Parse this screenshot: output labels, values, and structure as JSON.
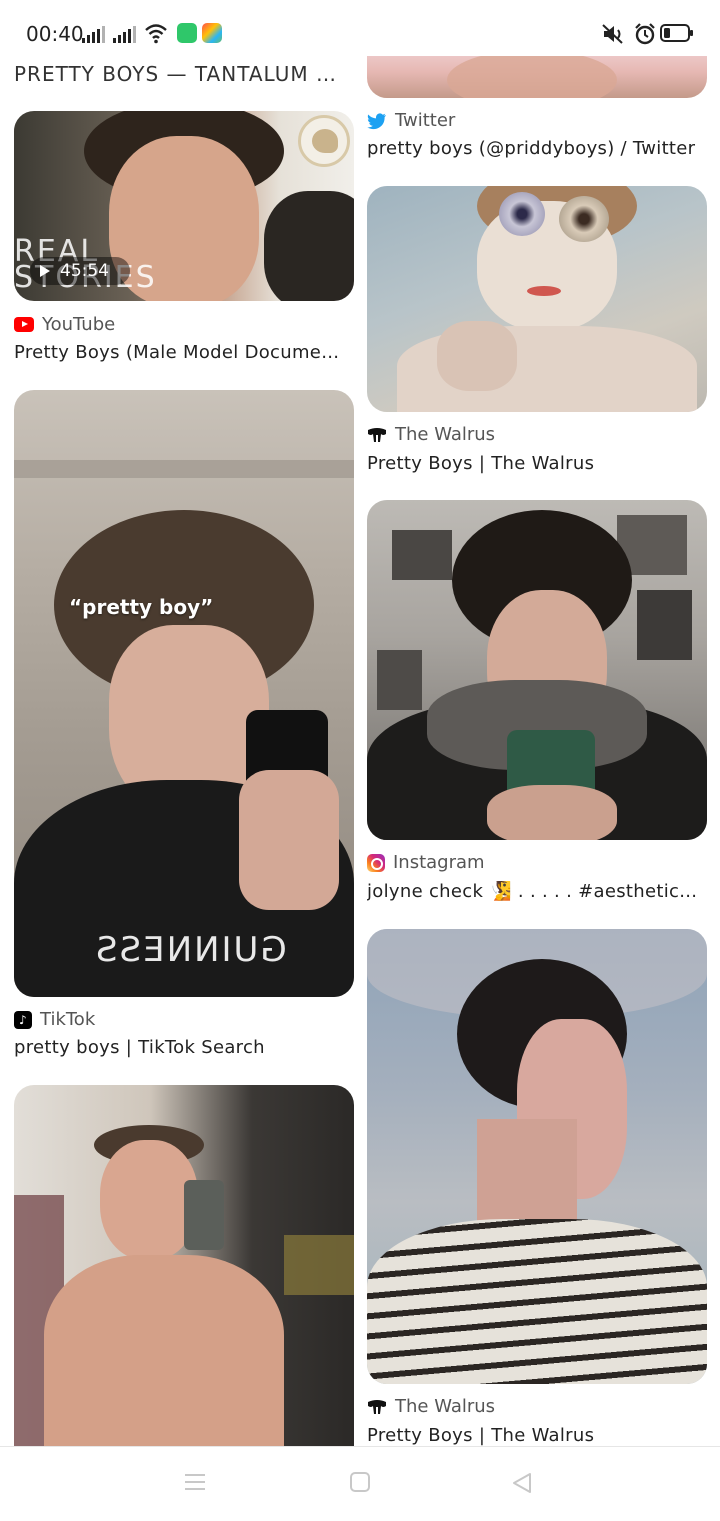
{
  "status": {
    "time": "00:40"
  },
  "header": {
    "top_caption": "PRETTY BOYS — TANTALUM MA..."
  },
  "video": {
    "duration": "45:54",
    "overlay_text": "REAL STORIES"
  },
  "left_col": [
    {
      "source": "YouTube",
      "title": "Pretty Boys (Male Model Document..."
    },
    {
      "source": "TikTok",
      "title": "pretty boys | TikTok Search",
      "overlay": "“pretty boy”",
      "shirt_text": "GUINNESS"
    },
    {
      "source": "",
      "title": ""
    }
  ],
  "right_col": [
    {
      "source": "Twitter",
      "title": "pretty boys (@priddyboys) / Twitter"
    },
    {
      "source": "The Walrus",
      "title": "Pretty Boys | The Walrus"
    },
    {
      "source": "Instagram",
      "title": "jolyne check 🧏 . . . . . #aesthetic..."
    },
    {
      "source": "The Walrus",
      "title": "Pretty Boys | The Walrus"
    }
  ],
  "colors": {
    "youtube": "#ff0000",
    "twitter": "#1da1f2",
    "tiktok": "#000000",
    "instagram": "#d6249f",
    "walrus": "#111111",
    "nav_icon": "#c8c8c8"
  },
  "icons": {
    "status": [
      "signal-icon",
      "signal-icon",
      "wifi-icon",
      "chat-app-icon",
      "shop-app-icon",
      "mute-icon",
      "alarm-icon",
      "battery-icon"
    ],
    "nav": [
      "menu-icon",
      "home-icon",
      "back-icon"
    ]
  }
}
